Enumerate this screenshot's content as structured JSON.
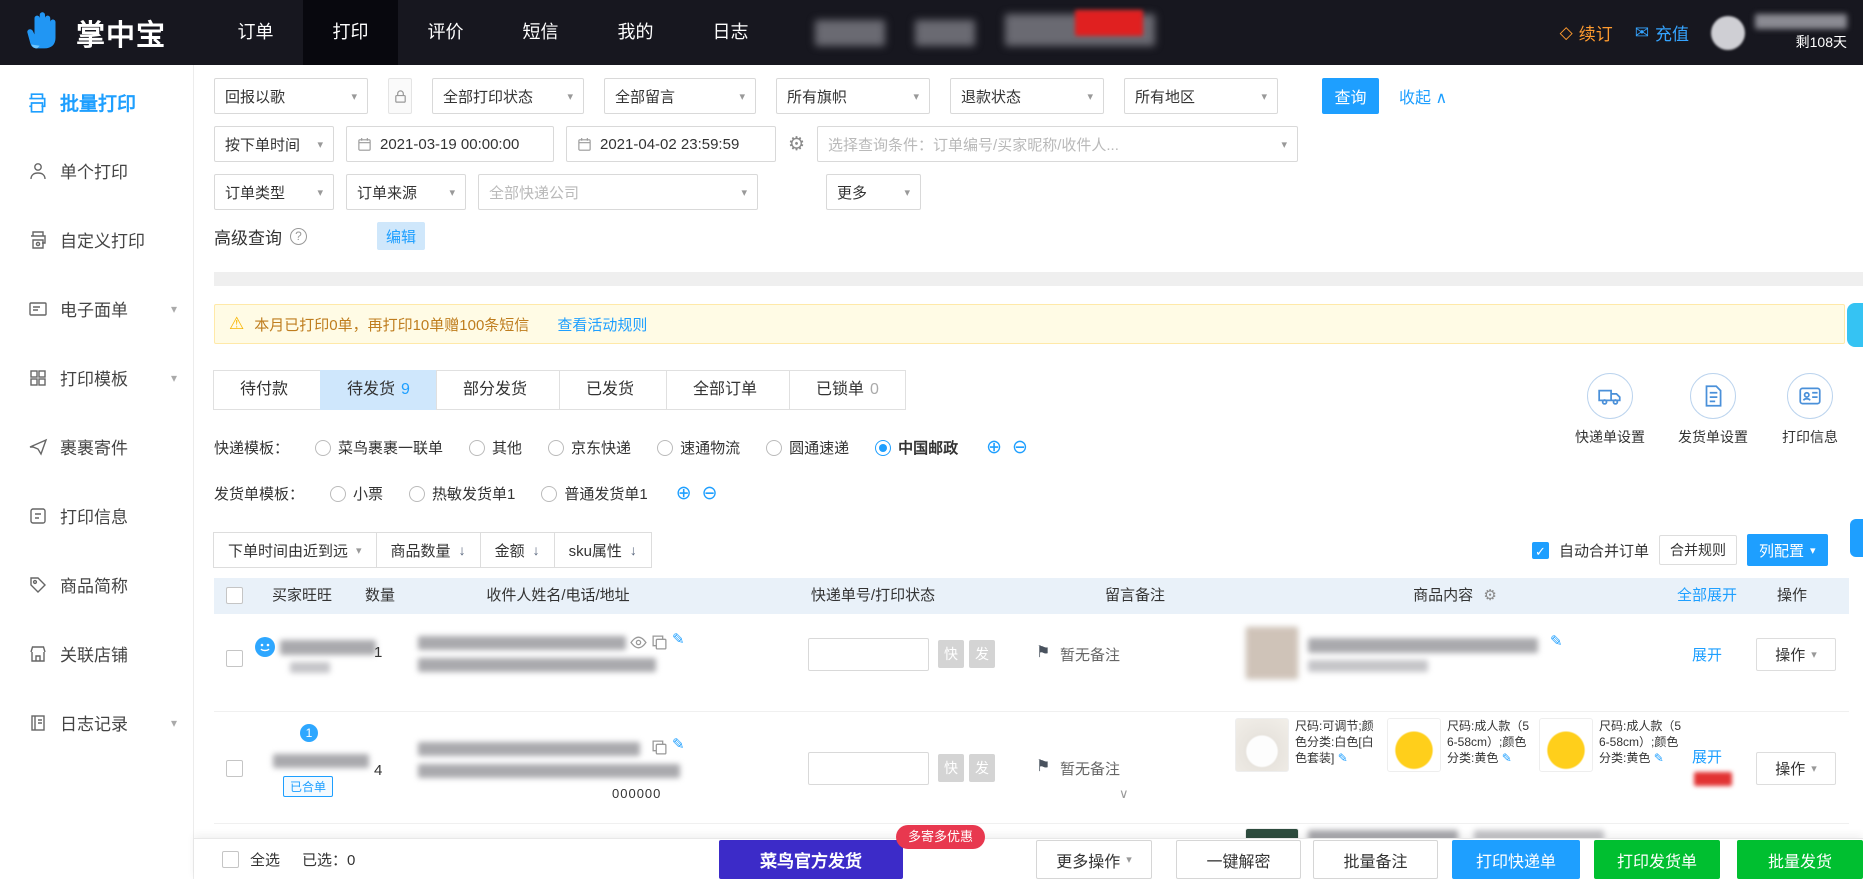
{
  "navbar": {
    "logo_text": "掌中宝",
    "menu": [
      {
        "label": "订单"
      },
      {
        "label": "打印"
      },
      {
        "label": "评价"
      },
      {
        "label": "短信"
      },
      {
        "label": "我的"
      },
      {
        "label": "日志"
      }
    ],
    "renew": "续订",
    "recharge": "充值",
    "days_left": "剩108天"
  },
  "sidebar": {
    "items": [
      {
        "label": "批量打印"
      },
      {
        "label": "单个打印"
      },
      {
        "label": "自定义打印"
      },
      {
        "label": "电子面单"
      },
      {
        "label": "打印模板"
      },
      {
        "label": "裹裹寄件"
      },
      {
        "label": "打印信息"
      },
      {
        "label": "商品简称"
      },
      {
        "label": "关联店铺"
      },
      {
        "label": "日志记录"
      }
    ]
  },
  "filters": {
    "preset": "回报以歌",
    "print_status": "全部打印状态",
    "message": "全部留言",
    "flag": "所有旗帜",
    "refund": "退款状态",
    "region": "所有地区",
    "query": "查询",
    "collapse": "收起",
    "time_type": "按下单时间",
    "date_from": "2021-03-19 00:00:00",
    "date_to": "2021-04-02 23:59:59",
    "keyword_placeholder": "选择查询条件：订单编号/买家昵称/收件人...",
    "order_type": "订单类型",
    "order_source": "订单来源",
    "courier": "全部快递公司",
    "more": "更多",
    "advanced": "高级查询",
    "edit": "编辑"
  },
  "notice": {
    "text": "本月已打印0单，再打印10单赠100条短信",
    "link": "查看活动规则"
  },
  "tabs": [
    {
      "label": "待付款",
      "count": ""
    },
    {
      "label": "待发货",
      "count": "9"
    },
    {
      "label": "部分发货",
      "count": ""
    },
    {
      "label": "已发货",
      "count": ""
    },
    {
      "label": "全部订单",
      "count": ""
    },
    {
      "label": "已锁单",
      "count": "0"
    }
  ],
  "quick_settings": [
    {
      "label": "快递单设置"
    },
    {
      "label": "发货单设置"
    },
    {
      "label": "打印信息"
    }
  ],
  "express_template": {
    "label": "快递模板：",
    "options": [
      {
        "label": "菜鸟裹裹一联单"
      },
      {
        "label": "其他"
      },
      {
        "label": "京东快递"
      },
      {
        "label": "速通物流"
      },
      {
        "label": "圆通速递"
      },
      {
        "label": "中国邮政"
      }
    ],
    "selected": "中国邮政"
  },
  "invoice_template": {
    "label": "发货单模板：",
    "options": [
      {
        "label": "小票"
      },
      {
        "label": "热敏发货单1"
      },
      {
        "label": "普通发货单1"
      }
    ]
  },
  "toolbar": {
    "sort_time": "下单时间由近到远",
    "sort_qty": "商品数量",
    "sort_amount": "金额",
    "sort_sku": "sku属性",
    "auto_merge": "自动合并订单",
    "merge_rules": "合并规则",
    "column_config": "列配置"
  },
  "table": {
    "headers": {
      "buyer": "买家旺旺",
      "qty": "数量",
      "recipient": "收件人姓名/电话/地址",
      "tracking": "快递单号/打印状态",
      "note": "留言备注",
      "product": "商品内容",
      "expand_all": "全部展开",
      "action": "操作"
    },
    "quick": {
      "fast": "快",
      "ship": "发"
    },
    "rows": [
      {
        "qty": "1",
        "note": "暂无备注",
        "expand": "展开",
        "action": "操作"
      },
      {
        "qty": "4",
        "wang_count": "1",
        "merged_badge": "已合单",
        "postal": "000000",
        "note": "暂无备注",
        "expand": "展开",
        "action": "操作",
        "products": [
          {
            "spec": "尺码:可调节;颜色分类:白色[白色套装]"
          },
          {
            "spec": "尺码:成人款（56-58cm）;颜色分类:黄色"
          },
          {
            "spec": "尺码:成人款（56-58cm）;颜色分类:黄色"
          }
        ]
      }
    ]
  },
  "footer": {
    "select_all": "全选",
    "selected": "已选：0",
    "cainiao_ship": "菜鸟官方发货",
    "promo": "多寄多优惠",
    "more_actions": "更多操作",
    "decrypt": "一键解密",
    "batch_note": "批量备注",
    "print_express": "打印快递单",
    "print_invoice": "打印发货单",
    "batch_ship": "批量发货"
  },
  "icons": {
    "chevron_down": "▾",
    "chevron_small": "∨",
    "collapse_up": "∧",
    "gear": "⚙",
    "flag": "⚑",
    "edit": "✎",
    "plus": "⊕",
    "minus": "⊖",
    "warning": "⚠",
    "help": "?",
    "check": "✓",
    "renew_diamond": "◇",
    "mail": "✉",
    "arrow_down": "↓"
  },
  "colors": {
    "primary_blue": "#1e9fff",
    "green": "#00bf30",
    "indigo": "#3c2bc8",
    "navbar_bg": "#17171f",
    "annotation_red": "#f1211c"
  }
}
